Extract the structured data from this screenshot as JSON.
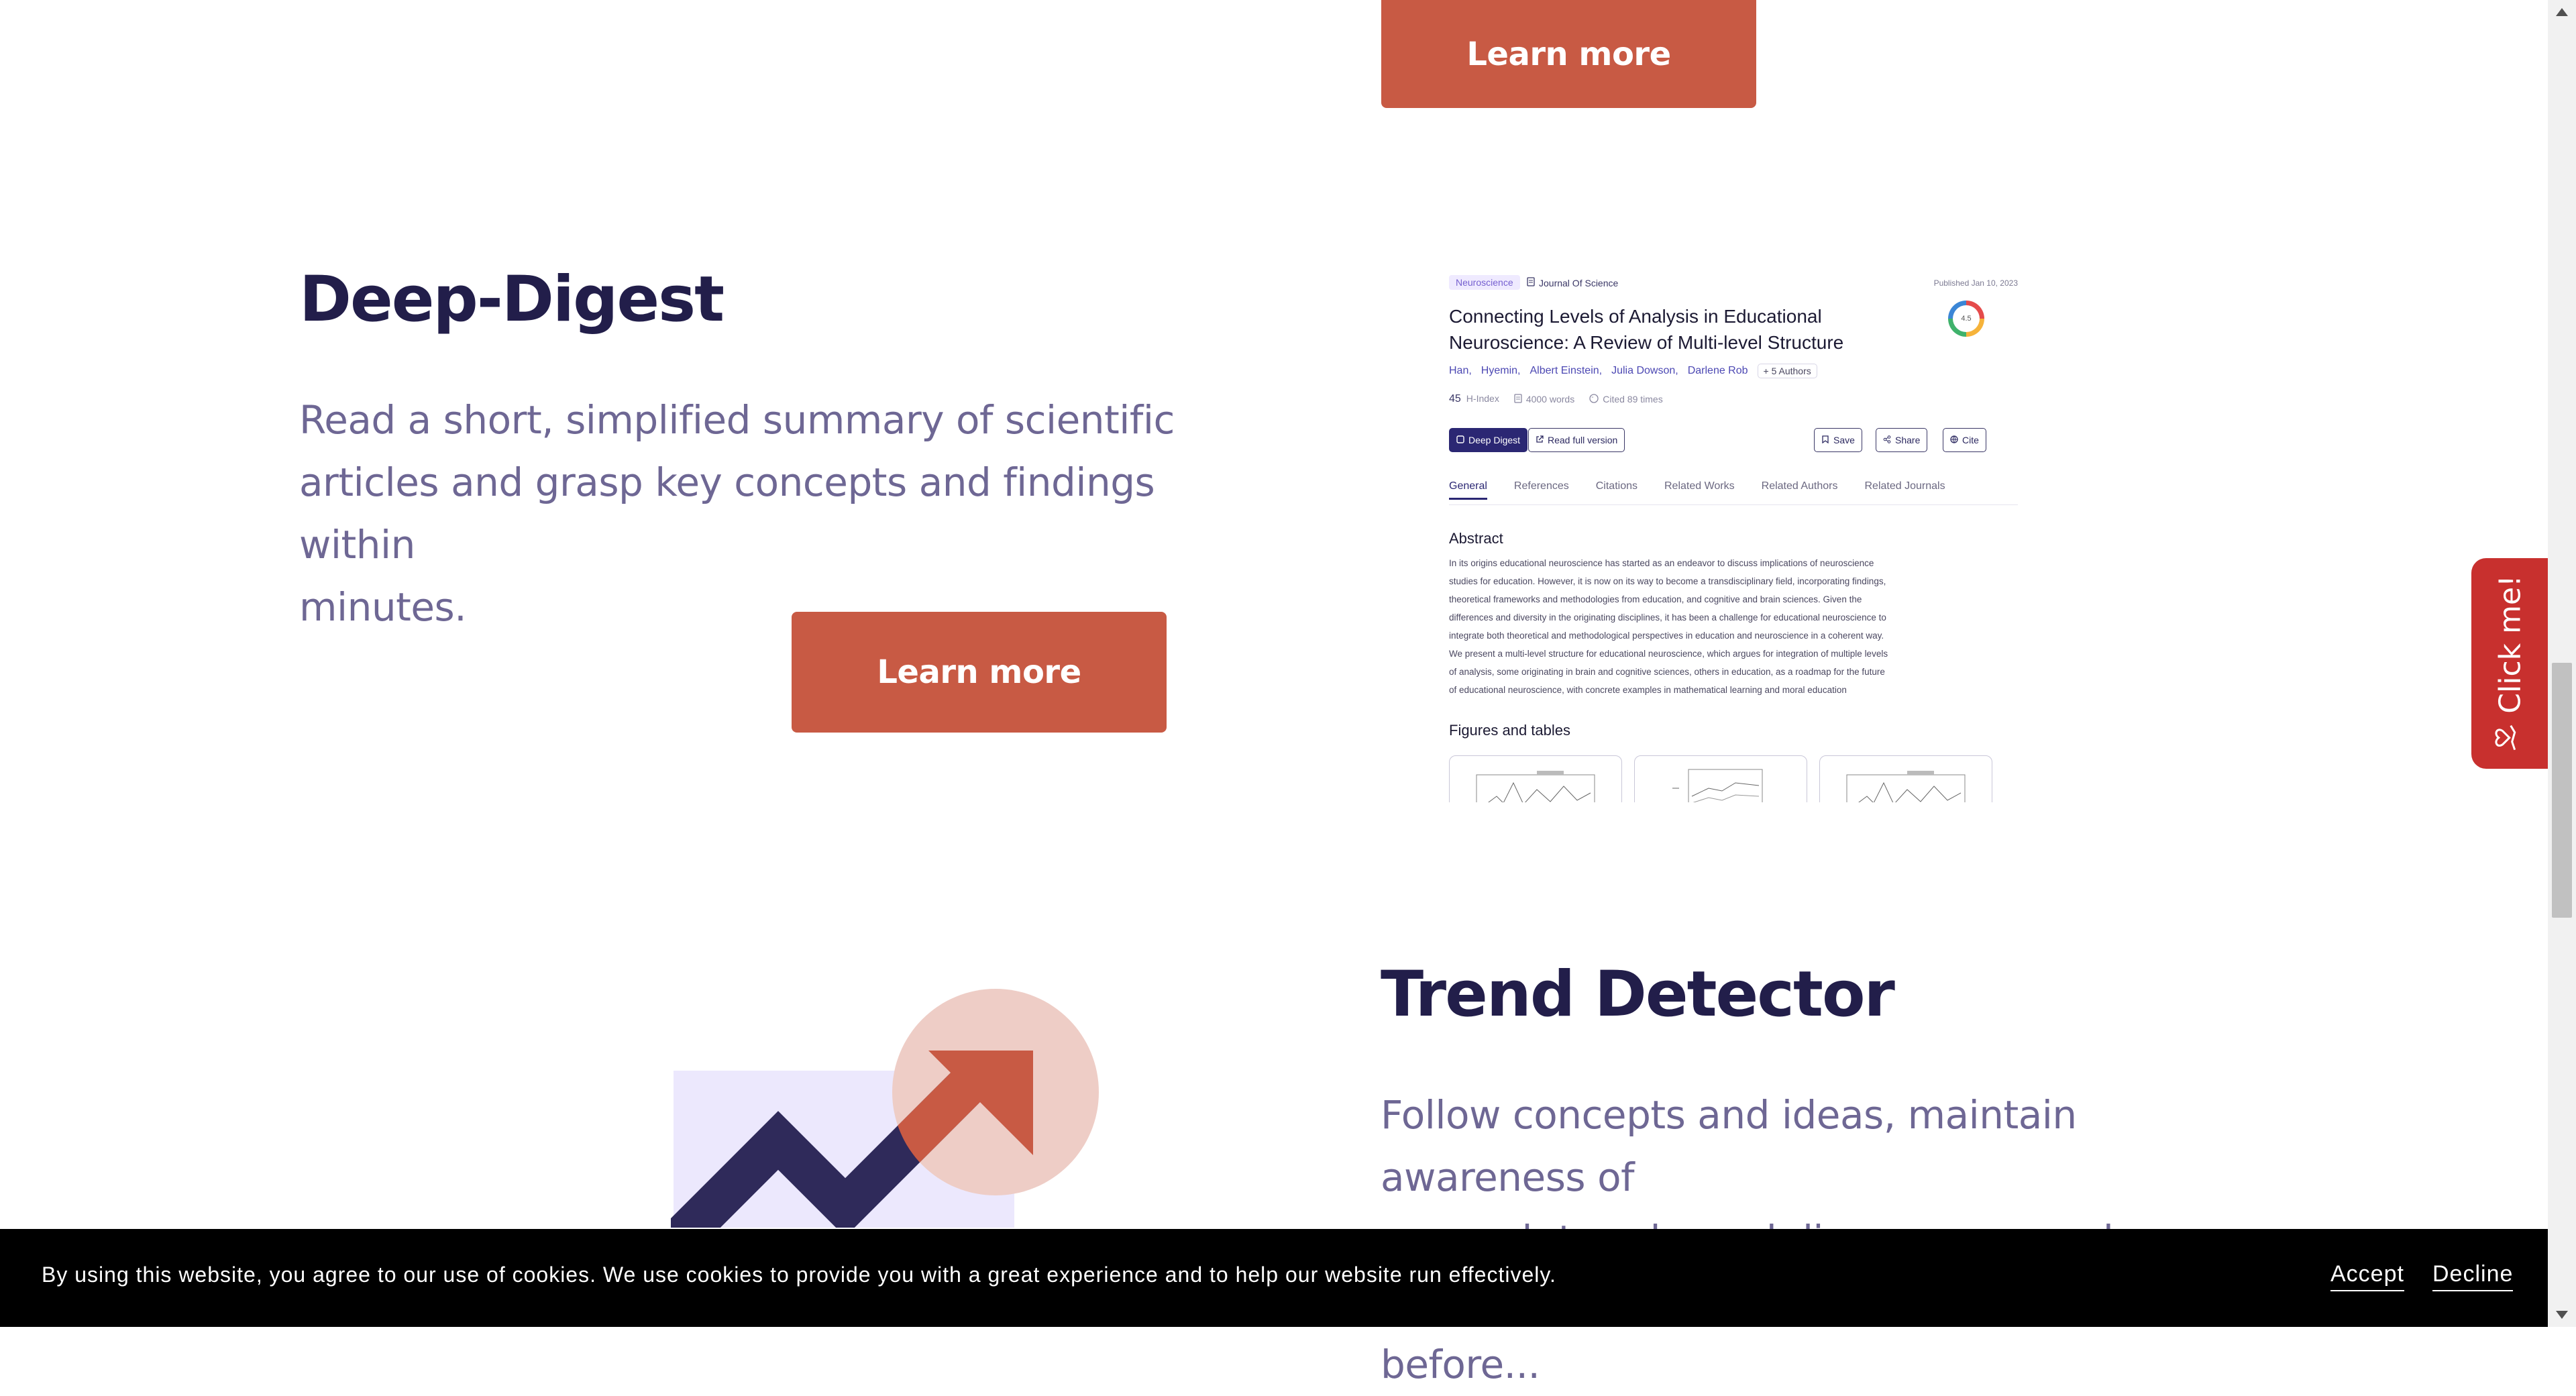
{
  "sections": {
    "top": {
      "learn_more": "Learn more"
    },
    "deep_digest": {
      "title": "Deep-Digest",
      "description_lines": [
        "Read a short, simplified summary of scientific",
        "articles and grasp key concepts and findings within",
        "minutes."
      ],
      "learn_more": "Learn more"
    },
    "trend_detector": {
      "title": "Trend Detector",
      "description_lines": [
        "Follow concepts and ideas, maintain awareness of",
        "research trends, and discover research triggers",
        "before..."
      ]
    }
  },
  "preview": {
    "tag": "Neuroscience",
    "journal": "Journal Of Science",
    "published": "Published Jan 10, 2023",
    "title": "Connecting Levels of Analysis in Educational Neuroscience: A Review of Multi-level Structure",
    "score": "4.5",
    "authors": [
      "Han,",
      "Hyemin,",
      "Albert Einstein,",
      "Julia Dowson,",
      "Darlene Rob"
    ],
    "more_authors": "+ 5 Authors",
    "metrics": {
      "h_index_value": "45",
      "h_index_label": "H-Index",
      "words": "4000 words",
      "cited": "Cited 89 times"
    },
    "actions": {
      "deep_digest": "Deep Digest",
      "read_full": "Read full version",
      "save": "Save",
      "share": "Share",
      "cite": "Cite"
    },
    "tabs": [
      "General",
      "References",
      "Citations",
      "Related Works",
      "Related Authors",
      "Related Journals"
    ],
    "active_tab": "General",
    "abstract_heading": "Abstract",
    "abstract_lines": [
      "In its origins educational neuroscience has started as an endeavor to discuss implications of neuroscience",
      "studies for education. However, it is now on its way to become a transdisciplinary field, incorporating findings,",
      "theoretical frameworks and methodologies from education, and cognitive and brain sciences. Given the",
      "differences and diversity in the originating disciplines, it has been a challenge for educational neuroscience to",
      "integrate both theoretical and methodological perspectives in education and neuroscience in a coherent way.",
      "We present a multi-level structure for educational neuroscience, which argues for integration of multiple levels",
      "of analysis, some originating in brain and cognitive sciences, others in education, as a roadmap for the future",
      "of educational neuroscience, with concrete examples in mathematical learning and moral education"
    ],
    "figures_heading": "Figures and tables"
  },
  "side_tab": {
    "label": "Click me!"
  },
  "cookie": {
    "text": "By using this website, you agree to our use of cookies. We use cookies to provide you with a great experience and to help our website run effectively.",
    "accept": "Accept",
    "decline": "Decline"
  },
  "colors": {
    "accent": "#c85a44",
    "heading": "#221e4a",
    "body": "#6e6794",
    "side_tab": "#c8302e",
    "brand_dark": "#2b2773"
  }
}
